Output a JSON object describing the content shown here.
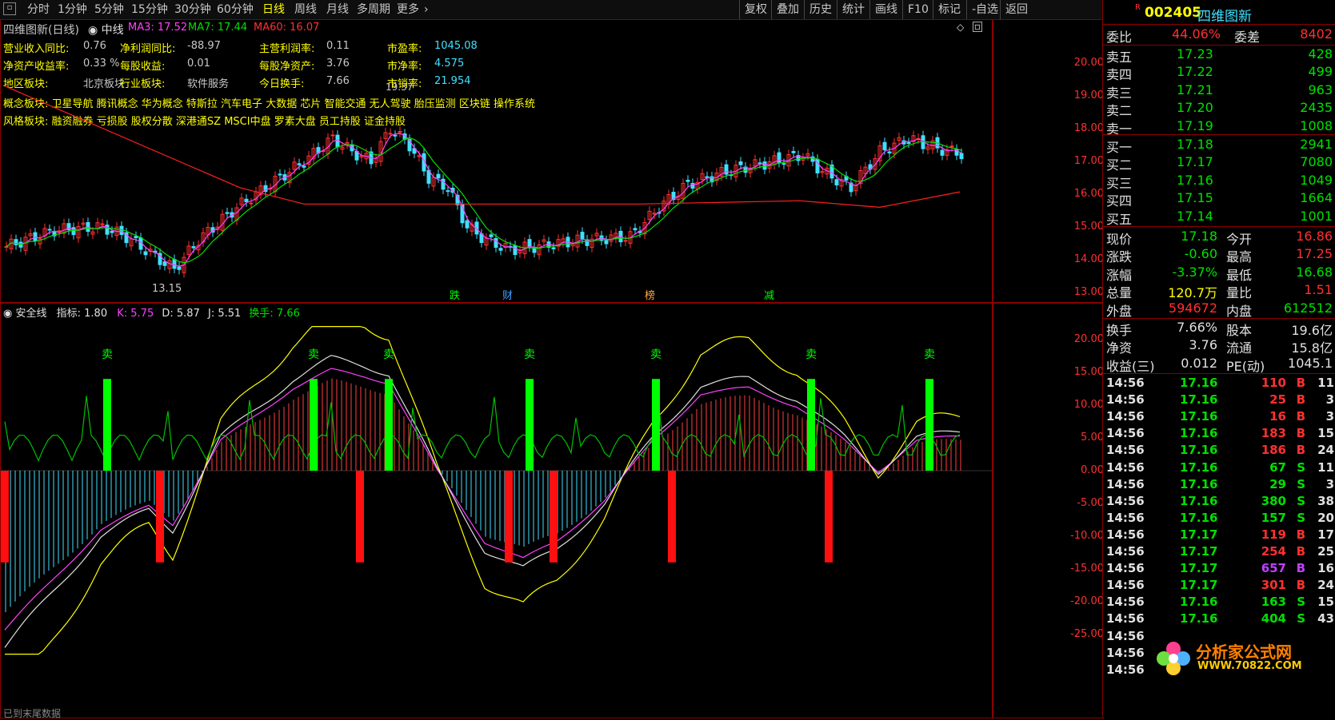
{
  "toolbar": {
    "periods": [
      "分时",
      "1分钟",
      "5分钟",
      "15分钟",
      "30分钟",
      "60分钟",
      "日线",
      "周线",
      "月线",
      "多周期",
      "更多"
    ],
    "active_period": "日线",
    "right_buttons": [
      "复权",
      "叠加",
      "历史",
      "统计",
      "画线",
      "F10",
      "标记",
      "-自选",
      "返回"
    ]
  },
  "main_chart": {
    "title": "四维图新(日线)",
    "mode": "中线",
    "ma3_label": "MA3: 17.52",
    "ma7_label": "MA7: 17.44",
    "ma60_label": "MA60: 16.07",
    "fundamentals": [
      {
        "label": "营业收入同比:",
        "value": "0.76"
      },
      {
        "label": "净利润同比:",
        "value": "-88.97"
      },
      {
        "label": "主营利润率:",
        "value": "0.11"
      },
      {
        "label": "市盈率:",
        "value": "1045.08"
      },
      {
        "label": "净资产收益率:",
        "value": "0.33 %"
      },
      {
        "label": "每股收益:",
        "value": "0.01"
      },
      {
        "label": "每股净资产:",
        "value": "3.76"
      },
      {
        "label": "市净率:",
        "value": "4.575"
      },
      {
        "label": "地区板块:",
        "value": "北京板块"
      },
      {
        "label": "行业板块:",
        "value": "软件服务"
      },
      {
        "label": "今日换手:",
        "value": "7.66"
      },
      {
        "label": "市销率:",
        "value": "21.954"
      }
    ],
    "concept_label": "概念板块:",
    "concept_value": "卫星导航 腾讯概念 华为概念 特斯拉 汽车电子 大数据 芯片 智能交通 无人驾驶 胎压监测 区块链 操作系统",
    "style_label": "风格板块:",
    "style_value": "融资融券 亏损股 股权分散 深港通SZ MSCI中盘 罗素大盘 员工持股 证金持股",
    "low_marker": "13.15",
    "high_marker": "19.37",
    "event_tags": [
      "跌",
      "财",
      "榜",
      "减"
    ],
    "y_axis": [
      "20.00",
      "19.00",
      "18.00",
      "17.00",
      "16.00",
      "15.00",
      "14.00",
      "13.00"
    ]
  },
  "indicator": {
    "name": "安全线",
    "zb_label": "指标: 1.80",
    "k_label": "K: 5.75",
    "d_label": "D: 5.87",
    "j_label": "J: 5.51",
    "hs_label": "换手: 7.66",
    "sell_label": "卖",
    "y_axis": [
      "20.00",
      "15.00",
      "10.00",
      "5.00",
      "0.00",
      "-5.00",
      "-10.00",
      "-15.00",
      "-20.00",
      "-25.00"
    ],
    "footer": "已到末尾数据"
  },
  "quote": {
    "code": "002405",
    "name": "四维图新",
    "flag": "R",
    "wb_label": "委比",
    "wb_value": "44.06%",
    "wc_label": "委差",
    "wc_value": "8402",
    "asks": [
      {
        "label": "卖五",
        "price": "17.23",
        "vol": "428"
      },
      {
        "label": "卖四",
        "price": "17.22",
        "vol": "499"
      },
      {
        "label": "卖三",
        "price": "17.21",
        "vol": "963"
      },
      {
        "label": "卖二",
        "price": "17.20",
        "vol": "2435"
      },
      {
        "label": "卖一",
        "price": "17.19",
        "vol": "1008"
      }
    ],
    "bids": [
      {
        "label": "买一",
        "price": "17.18",
        "vol": "2941"
      },
      {
        "label": "买二",
        "price": "17.17",
        "vol": "7080"
      },
      {
        "label": "买三",
        "price": "17.16",
        "vol": "1049"
      },
      {
        "label": "买四",
        "price": "17.15",
        "vol": "1664"
      },
      {
        "label": "买五",
        "price": "17.14",
        "vol": "1001"
      }
    ],
    "stats": [
      {
        "l1": "现价",
        "v1": "17.18",
        "l2": "今开",
        "v2": "16.86"
      },
      {
        "l1": "涨跌",
        "v1": "-0.60",
        "l2": "最高",
        "v2": "17.25"
      },
      {
        "l1": "涨幅",
        "v1": "-3.37%",
        "l2": "最低",
        "v2": "16.68"
      },
      {
        "l1": "总量",
        "v1": "120.7万",
        "l2": "量比",
        "v2": "1.51"
      },
      {
        "l1": "外盘",
        "v1": "594672",
        "l2": "内盘",
        "v2": "612512"
      }
    ],
    "stats2": [
      {
        "l1": "换手",
        "v1": "7.66%",
        "l2": "股本",
        "v2": "19.6亿"
      },
      {
        "l1": "净资",
        "v1": "3.76",
        "l2": "流通",
        "v2": "15.8亿"
      },
      {
        "l1": "收益(三)",
        "v1": "0.012",
        "l2": "PE(动)",
        "v2": "1045.1"
      }
    ],
    "ticks": [
      {
        "t": "14:56",
        "p": "17.16",
        "v": "110",
        "s": "B",
        "n": "11"
      },
      {
        "t": "14:56",
        "p": "17.16",
        "v": "25",
        "s": "B",
        "n": "3"
      },
      {
        "t": "14:56",
        "p": "17.16",
        "v": "16",
        "s": "B",
        "n": "3"
      },
      {
        "t": "14:56",
        "p": "17.16",
        "v": "183",
        "s": "B",
        "n": "15"
      },
      {
        "t": "14:56",
        "p": "17.16",
        "v": "186",
        "s": "B",
        "n": "24"
      },
      {
        "t": "14:56",
        "p": "17.16",
        "v": "67",
        "s": "S",
        "n": "11"
      },
      {
        "t": "14:56",
        "p": "17.16",
        "v": "29",
        "s": "S",
        "n": "3"
      },
      {
        "t": "14:56",
        "p": "17.16",
        "v": "380",
        "s": "S",
        "n": "38"
      },
      {
        "t": "14:56",
        "p": "17.16",
        "v": "157",
        "s": "S",
        "n": "20"
      },
      {
        "t": "14:56",
        "p": "17.17",
        "v": "119",
        "s": "B",
        "n": "17"
      },
      {
        "t": "14:56",
        "p": "17.17",
        "v": "254",
        "s": "B",
        "n": "25"
      },
      {
        "t": "14:56",
        "p": "17.17",
        "v": "657",
        "s": "B",
        "n": "16"
      },
      {
        "t": "14:56",
        "p": "17.17",
        "v": "301",
        "s": "B",
        "n": "24"
      },
      {
        "t": "14:56",
        "p": "17.16",
        "v": "163",
        "s": "S",
        "n": "15"
      },
      {
        "t": "14:56",
        "p": "17.16",
        "v": "404",
        "s": "S",
        "n": "43"
      },
      {
        "t": "14:56",
        "p": "",
        "v": "",
        "s": "",
        "n": ""
      },
      {
        "t": "14:56",
        "p": "",
        "v": "",
        "s": "",
        "n": ""
      },
      {
        "t": "14:56",
        "p": "",
        "v": "",
        "s": "",
        "n": ""
      }
    ]
  },
  "watermark": {
    "name": "分析家公式网",
    "url": "WWW.70822.COM"
  },
  "colors": {
    "up": "#ff3030",
    "down": "#40e0ff",
    "ma3": "#ff40ff",
    "ma7": "#00e000",
    "ma60": "#ff2020",
    "k": "#e0e0e0",
    "d": "#ff40ff",
    "j": "#ffff00"
  }
}
